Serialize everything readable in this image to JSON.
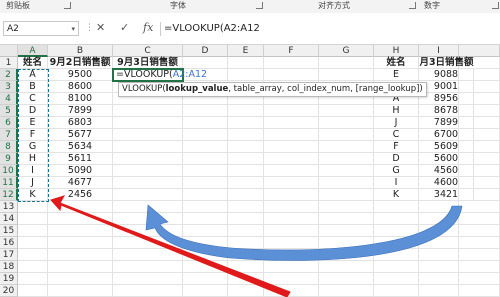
{
  "ribbon": {
    "groups": [
      "剪贴板",
      "字体",
      "对齐方式",
      "数字"
    ]
  },
  "formula_bar": {
    "name_box": "A2",
    "dropdown_glyph": "▾",
    "more_glyph": "⋮",
    "cancel_glyph": "✕",
    "enter_glyph": "✓",
    "fx_glyph": "fx",
    "content": "=VLOOKUP(A2:A12"
  },
  "columns": [
    "A",
    "B",
    "C",
    "D",
    "E",
    "F",
    "G",
    "H",
    "I"
  ],
  "rows": [
    "1",
    "2",
    "3",
    "4",
    "5",
    "6",
    "7",
    "8",
    "9",
    "10",
    "11",
    "12",
    "13",
    "14",
    "15",
    "16",
    "17",
    "18",
    "19",
    "20"
  ],
  "headers": {
    "name": "姓名",
    "sep2_sales": "9月2日销售额",
    "sep3_sales": "9月3日销售额",
    "name2": "姓名",
    "month3_sales": "月3日销售额"
  },
  "table_left": [
    {
      "name": "A",
      "sales": "9500"
    },
    {
      "name": "B",
      "sales": "8600"
    },
    {
      "name": "C",
      "sales": "8100"
    },
    {
      "name": "D",
      "sales": "7899"
    },
    {
      "name": "E",
      "sales": "6803"
    },
    {
      "name": "F",
      "sales": "5677"
    },
    {
      "name": "G",
      "sales": "5634"
    },
    {
      "name": "H",
      "sales": "5611"
    },
    {
      "name": "I",
      "sales": "5090"
    },
    {
      "name": "J",
      "sales": "4677"
    },
    {
      "name": "K",
      "sales": "2456"
    }
  ],
  "table_right": [
    {
      "name": "E",
      "sales": "9088"
    },
    {
      "name": "B",
      "sales": "9001"
    },
    {
      "name": "A",
      "sales": "8956"
    },
    {
      "name": "H",
      "sales": "8678"
    },
    {
      "name": "J",
      "sales": "7899"
    },
    {
      "name": "C",
      "sales": "6700"
    },
    {
      "name": "F",
      "sales": "5609"
    },
    {
      "name": "D",
      "sales": "5600"
    },
    {
      "name": "G",
      "sales": "4560"
    },
    {
      "name": "I",
      "sales": "4600"
    },
    {
      "name": "K",
      "sales": "3421"
    }
  ],
  "editing_cell": {
    "prefix": "=VLOOKUP(",
    "ref": "A2:A12"
  },
  "tooltip": {
    "func": "VLOOKUP(",
    "bold_arg": "lookup_value",
    "rest": ", table_array, col_index_num, [range_lookup])"
  },
  "colors": {
    "excel_green": "#217346",
    "selection_dash": "#1e6f8c",
    "ref_blue": "#4472c4",
    "red_arrow": "#e01a1a",
    "blue_arrow": "#5b8fd6"
  }
}
